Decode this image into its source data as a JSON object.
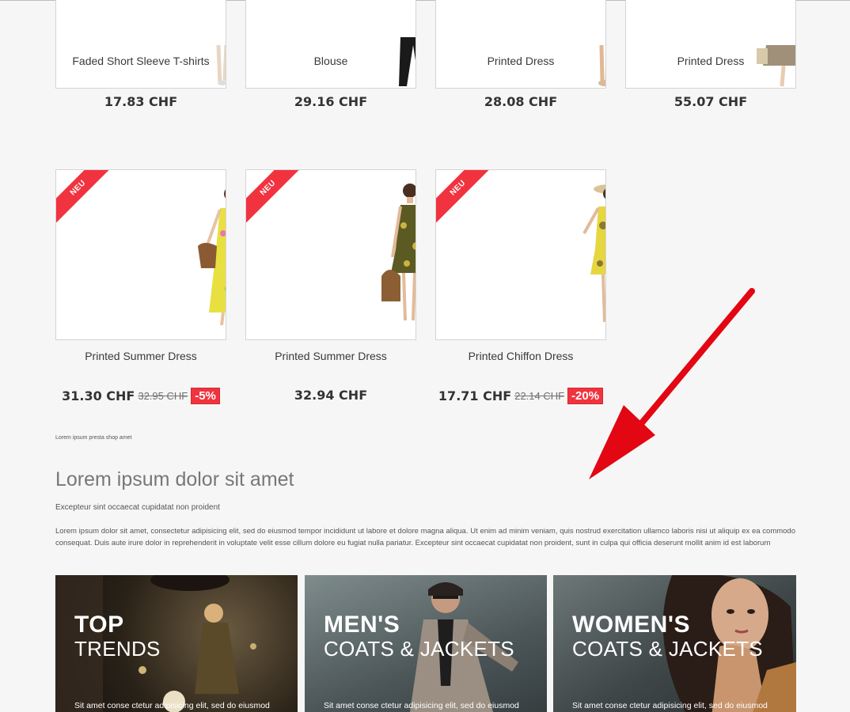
{
  "top_products": [
    {
      "name": "Faded Short Sleeve T-shirts",
      "price": "17.83 CHF"
    },
    {
      "name": "Blouse",
      "price": "29.16 CHF"
    },
    {
      "name": "Printed Dress",
      "price": "28.08 CHF"
    },
    {
      "name": "Printed Dress",
      "price": "55.07 CHF"
    }
  ],
  "new_products": [
    {
      "badge": "NEU",
      "name": "Printed Summer Dress",
      "price": "31.30 CHF",
      "old_price": "32.95 CHF",
      "discount": "-5%"
    },
    {
      "badge": "NEU",
      "name": "Printed Summer Dress",
      "price": "32.94 CHF"
    },
    {
      "badge": "NEU",
      "name": "Printed Chiffon Dress",
      "price": "17.71 CHF",
      "old_price": "22.14 CHF",
      "discount": "-20%"
    }
  ],
  "cms": {
    "small_note": "Lorem ipsum presta shop amet",
    "title": "Lorem ipsum dolor sit amet",
    "subtitle": "Excepteur sint occaecat cupidatat non proident",
    "paragraph": "Lorem ipsum dolor sit amet, consectetur adipisicing elit, sed do eiusmod tempor incididunt ut labore et dolore magna aliqua. Ut enim ad minim veniam, quis nostrud exercitation ullamco laboris nisi ut aliquip ex ea commodo consequat. Duis aute irure dolor in reprehenderit in voluptate velit esse cillum dolore eu fugiat nulla pariatur. Excepteur sint occaecat cupidatat non proident, sunt in culpa qui officia deserunt mollit anim id est laborum"
  },
  "banners": [
    {
      "line1": "TOP",
      "line2": "TRENDS",
      "caption": "Sit amet conse ctetur adipisicing elit, sed do eiusmod"
    },
    {
      "line1": "MEN'S",
      "line2": "COATS & JACKETS",
      "caption": "Sit amet conse ctetur adipisicing elit, sed do eiusmod"
    },
    {
      "line1": "WOMEN'S",
      "line2": "COATS & JACKETS",
      "caption": "Sit amet conse ctetur adipisicing elit, sed do eiusmod"
    }
  ],
  "colors": {
    "accent": "#f13340",
    "arrow": "#e30613",
    "background": "#f6f6f6"
  },
  "icons": {
    "annotation": "red-arrow-icon"
  }
}
